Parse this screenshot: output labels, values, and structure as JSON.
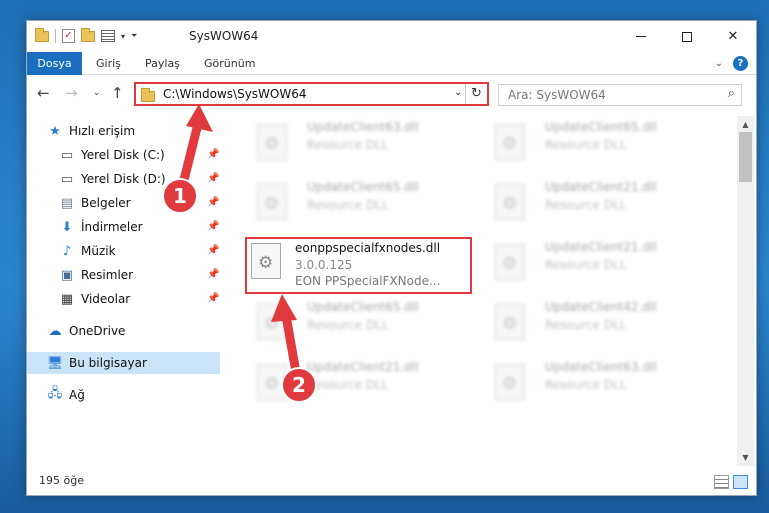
{
  "window": {
    "title": "SysWOW64"
  },
  "ribbon": {
    "tabs": [
      "Dosya",
      "Giriş",
      "Paylaş",
      "Görünüm"
    ]
  },
  "address": {
    "path": "C:\\Windows\\SysWOW64"
  },
  "search": {
    "placeholder": "Ara: SysWOW64"
  },
  "sidebar": {
    "quick_access": "Hızlı erişim",
    "items": [
      {
        "label": "Yerel Disk (C:)",
        "icon": "drive-icon"
      },
      {
        "label": "Yerel Disk (D:)",
        "icon": "drive-icon"
      },
      {
        "label": "Belgeler",
        "icon": "documents-icon"
      },
      {
        "label": "İndirmeler",
        "icon": "download-icon"
      },
      {
        "label": "Müzik",
        "icon": "music-icon"
      },
      {
        "label": "Resimler",
        "icon": "pictures-icon"
      },
      {
        "label": "Videolar",
        "icon": "videos-icon"
      }
    ],
    "onedrive": "OneDrive",
    "this_pc": "Bu bilgisayar",
    "network": "Ağ"
  },
  "files": {
    "left": [
      {
        "name": "UpdateClient63.dll",
        "desc": "Resource DLL"
      },
      {
        "name": "UpdateClient65.dll",
        "desc": "Resource DLL"
      },
      {
        "name": "UpdateClient65.dll",
        "desc": "Resource DLL"
      },
      {
        "name": "UpdateClient21.dll",
        "desc": "Resource DLL"
      }
    ],
    "right": [
      {
        "name": "UpdateClient65.dll",
        "desc": "Resource DLL"
      },
      {
        "name": "UpdateClient21.dll",
        "desc": "Resource DLL"
      },
      {
        "name": "UpdateClient21.dll",
        "desc": "Resource DLL"
      },
      {
        "name": "UpdateClient42.dll",
        "desc": "Resource DLL"
      },
      {
        "name": "UpdateClient63.dll",
        "desc": "Resource DLL"
      }
    ],
    "highlighted": {
      "name": "eonppspecialfxnodes.dll",
      "version": "3.0.0.125",
      "desc": "EON PPSpecialFXNode..."
    }
  },
  "status": {
    "count": "195 öğe"
  },
  "annotations": {
    "step1": "1",
    "step2": "2",
    "color": "#e0393e"
  }
}
